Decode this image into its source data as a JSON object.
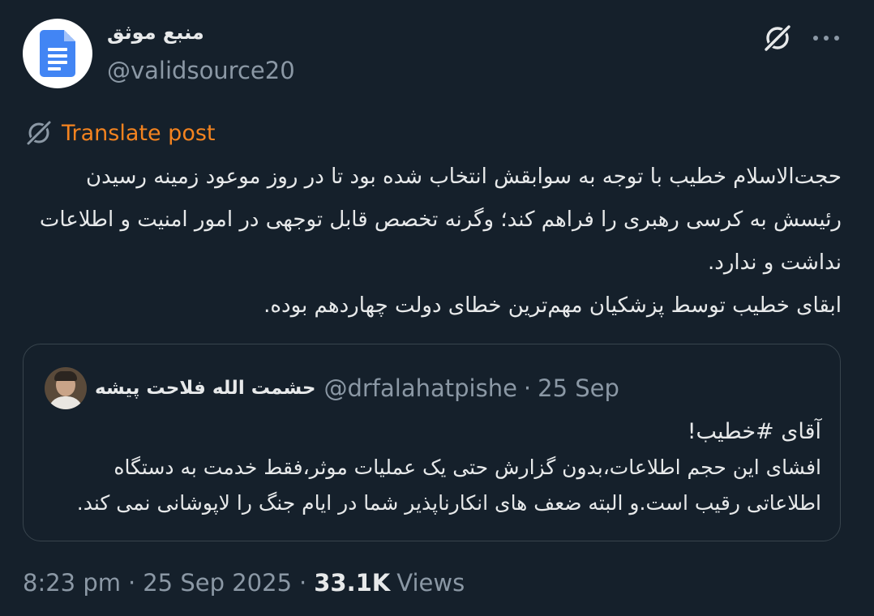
{
  "author": {
    "name": "منبع موثق",
    "handle": "@validsource20"
  },
  "translate_label": "Translate post",
  "body": [
    "حجت‌الاسلام خطیب با توجه به سوابقش انتخاب شده بود تا در روز موعود زمینه رسیدن رئیسش به کرسی رهبری را فراهم کند؛ وگرنه تخصص قابل توجهی در امور امنیت و اطلاعات نداشت و ندارد.",
    "ابقای خطیب توسط پزشکیان مهم‌ترین خطای دولت چهاردهم بوده."
  ],
  "quote": {
    "name": "حشمت الله فلاحت پیشه",
    "handle": "@drfalahatpishe",
    "separator": "·",
    "date": "25 Sep",
    "title": "آقای #خطیب!",
    "text": "افشای این حجم اطلاعات،بدون گزارش حتی یک عملیات موثر،فقط خدمت به دستگاه اطلاعاتی رقیب است.و البته ضعف های انکارناپذیر شما در ایام جنگ را لاپوشانی نمی کند."
  },
  "meta": {
    "time": "8:23 pm",
    "separator": "·",
    "date": "25 Sep 2025",
    "views_count": "33.1K",
    "views_label": "Views"
  },
  "colors": {
    "background": "#15202b",
    "text": "#e7e9ea",
    "secondary": "#8b98a5",
    "translate": "#f4831f",
    "border": "#38444d",
    "doc_icon": "#4285f4"
  },
  "icons": {
    "avatar": "google-docs-icon",
    "grok": "grok-icon",
    "more": "more-horizontal-icon",
    "translate": "grok-translate-icon"
  }
}
